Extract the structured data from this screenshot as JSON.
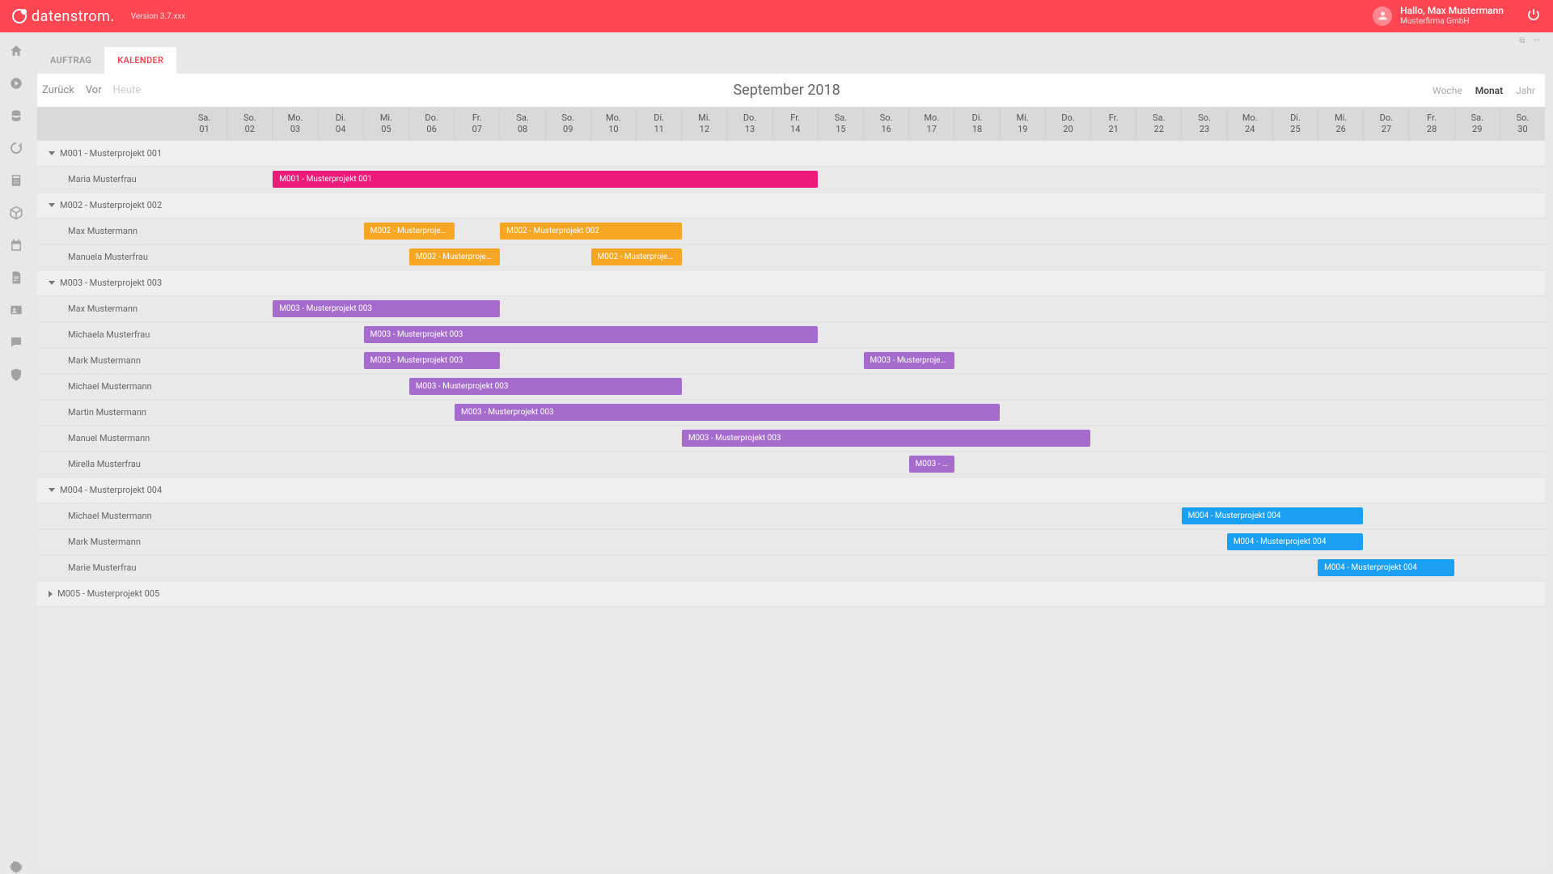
{
  "brand": {
    "name": "datenstrom.",
    "version": "Version 3.7.xxx"
  },
  "user": {
    "greeting": "Hallo, Max Mustermann",
    "company": "Musterfirma GmbH"
  },
  "tabs": [
    {
      "id": "auftrag",
      "label": "AUFTRAG",
      "active": false
    },
    {
      "id": "kalender",
      "label": "KALENDER",
      "active": true
    }
  ],
  "calendar": {
    "nav_back": "Zurück",
    "nav_fwd": "Vor",
    "nav_today": "Heute",
    "title": "September 2018",
    "view_week": "Woche",
    "view_month": "Monat",
    "view_year": "Jahr",
    "view_active": "Monat",
    "days": [
      {
        "wd": "Sa.",
        "d": "01"
      },
      {
        "wd": "So.",
        "d": "02"
      },
      {
        "wd": "Mo.",
        "d": "03"
      },
      {
        "wd": "Di.",
        "d": "04"
      },
      {
        "wd": "Mi.",
        "d": "05"
      },
      {
        "wd": "Do.",
        "d": "06"
      },
      {
        "wd": "Fr.",
        "d": "07"
      },
      {
        "wd": "Sa.",
        "d": "08"
      },
      {
        "wd": "So.",
        "d": "09"
      },
      {
        "wd": "Mo.",
        "d": "10"
      },
      {
        "wd": "Di.",
        "d": "11"
      },
      {
        "wd": "Mi.",
        "d": "12"
      },
      {
        "wd": "Do.",
        "d": "13"
      },
      {
        "wd": "Fr.",
        "d": "14"
      },
      {
        "wd": "Sa.",
        "d": "15"
      },
      {
        "wd": "So.",
        "d": "16"
      },
      {
        "wd": "Mo.",
        "d": "17"
      },
      {
        "wd": "Di.",
        "d": "18"
      },
      {
        "wd": "Mi.",
        "d": "19"
      },
      {
        "wd": "Do.",
        "d": "20"
      },
      {
        "wd": "Fr.",
        "d": "21"
      },
      {
        "wd": "Sa.",
        "d": "22"
      },
      {
        "wd": "So.",
        "d": "23"
      },
      {
        "wd": "Mo.",
        "d": "24"
      },
      {
        "wd": "Di.",
        "d": "25"
      },
      {
        "wd": "Mi.",
        "d": "26"
      },
      {
        "wd": "Do.",
        "d": "27"
      },
      {
        "wd": "Fr.",
        "d": "28"
      },
      {
        "wd": "Sa.",
        "d": "29"
      },
      {
        "wd": "So.",
        "d": "30"
      }
    ]
  },
  "colors": {
    "pink": "#ec1a78",
    "orange": "#f5a623",
    "purple": "#a56ccd",
    "blue": "#1b9ff1"
  },
  "groups": [
    {
      "name": "M001 - Musterprojekt 001",
      "open": true,
      "rows": [
        {
          "person": "Maria Musterfrau",
          "bars": [
            {
              "label": "M001 - Musterprojekt 001",
              "start": 3,
              "span": 12,
              "color": "pink"
            }
          ]
        }
      ]
    },
    {
      "name": "M002 - Musterprojekt 002",
      "open": true,
      "rows": [
        {
          "person": "Max Mustermann",
          "bars": [
            {
              "label": "M002 - Musterproje…",
              "start": 5,
              "span": 2,
              "color": "orange"
            },
            {
              "label": "M002 - Musterprojekt 002",
              "start": 8,
              "span": 4,
              "color": "orange"
            }
          ]
        },
        {
          "person": "Manuela Musterfrau",
          "bars": [
            {
              "label": "M002 - Musterproje…",
              "start": 6,
              "span": 2,
              "color": "orange"
            },
            {
              "label": "M002 - Musterproje…",
              "start": 10,
              "span": 2,
              "color": "orange"
            }
          ]
        }
      ]
    },
    {
      "name": "M003 - Musterprojekt 003",
      "open": true,
      "rows": [
        {
          "person": "Max Mustermann",
          "bars": [
            {
              "label": "M003 - Musterprojekt 003",
              "start": 3,
              "span": 5,
              "color": "purple"
            }
          ]
        },
        {
          "person": "Michaela Musterfrau",
          "bars": [
            {
              "label": "M003 - Musterprojekt 003",
              "start": 5,
              "span": 10,
              "color": "purple"
            }
          ]
        },
        {
          "person": "Mark Mustermann",
          "bars": [
            {
              "label": "M003 - Musterprojekt 003",
              "start": 5,
              "span": 3,
              "color": "purple"
            },
            {
              "label": "M003 - Musterproje…",
              "start": 16,
              "span": 2,
              "color": "purple"
            }
          ]
        },
        {
          "person": "Michael Mustermann",
          "bars": [
            {
              "label": "M003 - Musterprojekt 003",
              "start": 6,
              "span": 6,
              "color": "purple"
            }
          ]
        },
        {
          "person": "Martin Mustermann",
          "bars": [
            {
              "label": "M003 - Musterprojekt 003",
              "start": 7,
              "span": 12,
              "color": "purple"
            }
          ]
        },
        {
          "person": "Manuel Mustermann",
          "bars": [
            {
              "label": "M003 - Musterprojekt 003",
              "start": 12,
              "span": 9,
              "color": "purple"
            }
          ]
        },
        {
          "person": "Mirella Musterfrau",
          "bars": [
            {
              "label": "M003 - …",
              "start": 17,
              "span": 1,
              "color": "purple"
            }
          ]
        }
      ]
    },
    {
      "name": "M004 - Musterprojekt 004",
      "open": true,
      "rows": [
        {
          "person": "Michael Mustermann",
          "bars": [
            {
              "label": "M004 - Musterprojekt 004",
              "start": 23,
              "span": 4,
              "color": "blue"
            }
          ]
        },
        {
          "person": "Mark Mustermann",
          "bars": [
            {
              "label": "M004 - Musterprojekt 004",
              "start": 24,
              "span": 3,
              "color": "blue"
            }
          ]
        },
        {
          "person": "Marie Musterfrau",
          "bars": [
            {
              "label": "M004 - Musterprojekt 004",
              "start": 26,
              "span": 3,
              "color": "blue"
            }
          ]
        }
      ]
    },
    {
      "name": "M005 - Musterprojekt 005",
      "open": false,
      "rows": []
    }
  ]
}
